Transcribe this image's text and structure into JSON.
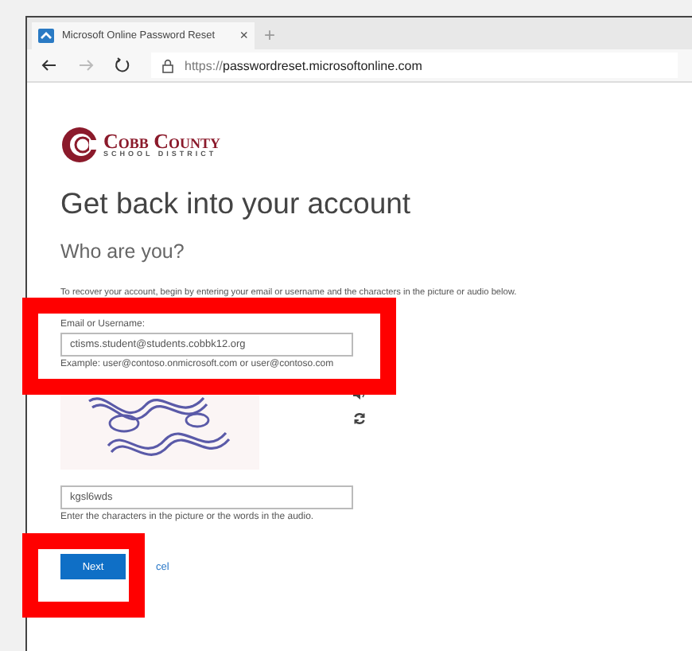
{
  "browser": {
    "tab_title": "Microsoft Online Password Reset",
    "close_tab": "×",
    "new_tab": "+",
    "url_prefix": "https://",
    "url_host": "passwordreset.microsoftonline.com"
  },
  "logo": {
    "name": "Cobb County",
    "subtitle": "SCHOOL DISTRICT"
  },
  "heading": "Get back into your account",
  "subheading": "Who are you?",
  "instruction": "To recover your account, begin by entering your email or username and the characters in the picture or audio below.",
  "email": {
    "label": "Email or Username:",
    "value": "ctisms.student@students.cobbk12.org",
    "example": "Example: user@contoso.onmicrosoft.com or user@contoso.com"
  },
  "captcha": {
    "kind": "picture",
    "value": "kgsl6wds",
    "hint": "Enter the characters in the picture or the words in the audio."
  },
  "buttons": [
    {
      "label": "Next",
      "kind": "primary"
    },
    {
      "label": "cel",
      "kind": "link"
    }
  ]
}
